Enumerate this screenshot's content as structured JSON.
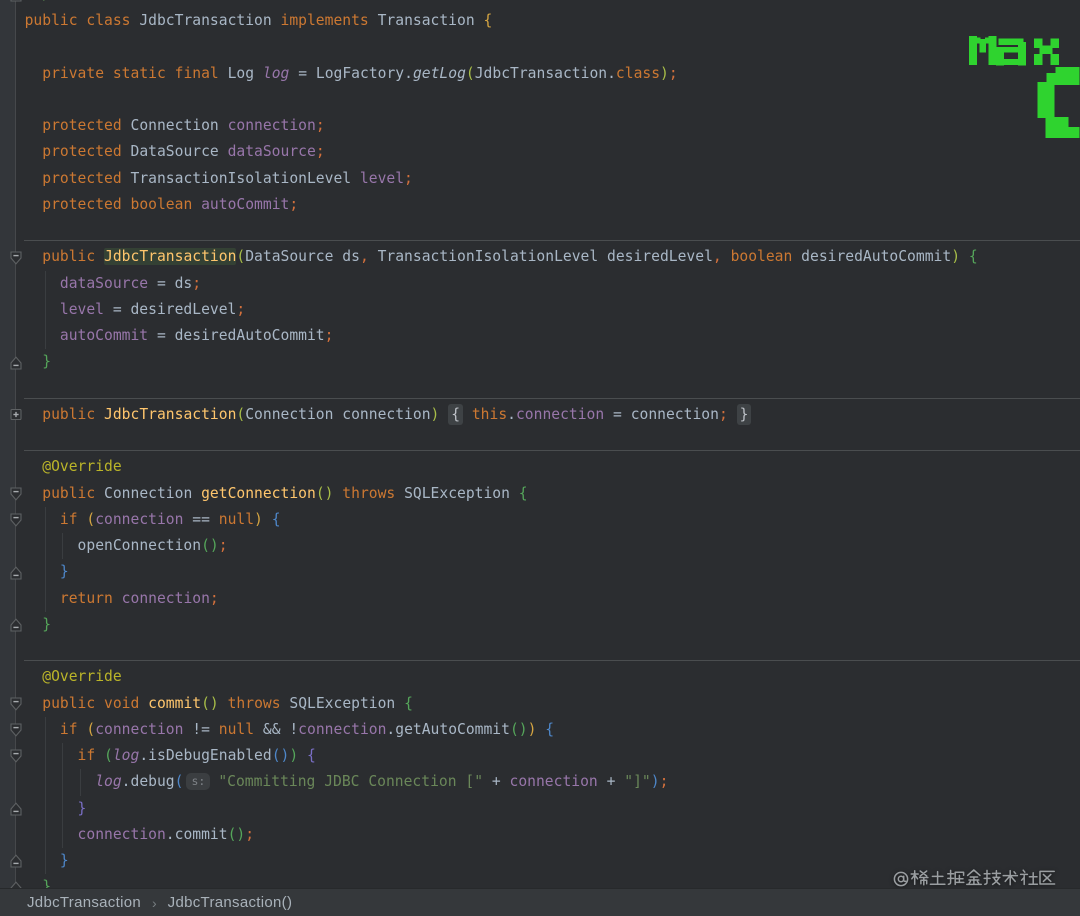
{
  "editor": {
    "language": "java",
    "colors": {
      "background": "#2B2D30",
      "gutter_background": "#33363A",
      "gutter_border": "#46484B",
      "keyword": "#CC7832",
      "text": "#A9B7C6",
      "field": "#9876AA",
      "method_declaration": "#FFC66D",
      "annotation": "#BBB529",
      "string": "#6A8759",
      "semicolon_comma": "#D2703C",
      "javadoc": "#629755",
      "bracket_gold": "#D5A542",
      "bracket_lime": "#A8BE48",
      "bracket_green": "#55A55A",
      "bracket_blue": "#4E87C9",
      "bracket_violet": "#7A6FC6",
      "identifier_under_caret_bg": "#344134",
      "folded_text_bg": "#3E4245",
      "method_separator": "#4A4D4F",
      "indent_guide": "#3A3D40"
    },
    "lines": [
      {
        "tokens": [
          [
            "dc",
            " */"
          ]
        ]
      },
      {
        "tokens": [
          [
            "kw",
            "public"
          ],
          [
            "tx",
            " "
          ],
          [
            "kw",
            "class"
          ],
          [
            "tx",
            " "
          ],
          [
            "tx",
            "JdbcTransaction"
          ],
          [
            "tx",
            " "
          ],
          [
            "kw",
            "implements"
          ],
          [
            "tx",
            " "
          ],
          [
            "tx",
            "Transaction"
          ],
          [
            "tx",
            " "
          ],
          [
            "b1",
            "{"
          ]
        ]
      },
      {
        "tokens": []
      },
      {
        "tokens": [
          [
            "tx",
            "  "
          ],
          [
            "kw",
            "private"
          ],
          [
            "tx",
            " "
          ],
          [
            "kw",
            "static"
          ],
          [
            "tx",
            " "
          ],
          [
            "kw",
            "final"
          ],
          [
            "tx",
            " "
          ],
          [
            "tx",
            "Log"
          ],
          [
            "tx",
            " "
          ],
          [
            "sf",
            "log"
          ],
          [
            "tx",
            " = "
          ],
          [
            "tx",
            "LogFactory"
          ],
          [
            "tx",
            "."
          ],
          [
            "sm",
            "getLog"
          ],
          [
            "b2",
            "("
          ],
          [
            "tx",
            "JdbcTransaction"
          ],
          [
            "tx",
            "."
          ],
          [
            "kw",
            "class"
          ],
          [
            "b2",
            ")"
          ],
          [
            "pu",
            ";"
          ]
        ]
      },
      {
        "tokens": []
      },
      {
        "tokens": [
          [
            "tx",
            "  "
          ],
          [
            "kw",
            "protected"
          ],
          [
            "tx",
            " Connection "
          ],
          [
            "fi",
            "connection"
          ],
          [
            "pu",
            ";"
          ]
        ]
      },
      {
        "tokens": [
          [
            "tx",
            "  "
          ],
          [
            "kw",
            "protected"
          ],
          [
            "tx",
            " DataSource "
          ],
          [
            "fi",
            "dataSource"
          ],
          [
            "pu",
            ";"
          ]
        ]
      },
      {
        "tokens": [
          [
            "tx",
            "  "
          ],
          [
            "kw",
            "protected"
          ],
          [
            "tx",
            " TransactionIsolationLevel "
          ],
          [
            "fi",
            "level"
          ],
          [
            "pu",
            ";"
          ]
        ]
      },
      {
        "tokens": [
          [
            "tx",
            "  "
          ],
          [
            "kw",
            "protected"
          ],
          [
            "tx",
            " "
          ],
          [
            "kw",
            "boolean"
          ],
          [
            "tx",
            " "
          ],
          [
            "fi",
            "autoCommit"
          ],
          [
            "pu",
            ";"
          ]
        ]
      },
      {
        "tokens": []
      },
      {
        "tokens": [
          [
            "tx",
            "  "
          ],
          [
            "kw",
            "public"
          ],
          [
            "tx",
            " "
          ],
          [
            "hm",
            "JdbcTransaction"
          ],
          [
            "b2",
            "("
          ],
          [
            "tx",
            "DataSource ds"
          ],
          [
            "pu",
            ","
          ],
          [
            "tx",
            " TransactionIsolationLevel desiredLevel"
          ],
          [
            "pu",
            ","
          ],
          [
            "tx",
            " "
          ],
          [
            "kw",
            "boolean"
          ],
          [
            "tx",
            " desiredAutoCommit"
          ],
          [
            "b2",
            ")"
          ],
          [
            "tx",
            " "
          ],
          [
            "b3",
            "{"
          ]
        ]
      },
      {
        "tokens": [
          [
            "tx",
            "    "
          ],
          [
            "fi",
            "dataSource"
          ],
          [
            "tx",
            " = ds"
          ],
          [
            "pu",
            ";"
          ]
        ]
      },
      {
        "tokens": [
          [
            "tx",
            "    "
          ],
          [
            "fi",
            "level"
          ],
          [
            "tx",
            " = desiredLevel"
          ],
          [
            "pu",
            ";"
          ]
        ]
      },
      {
        "tokens": [
          [
            "tx",
            "    "
          ],
          [
            "fi",
            "autoCommit"
          ],
          [
            "tx",
            " = desiredAutoCommit"
          ],
          [
            "pu",
            ";"
          ]
        ]
      },
      {
        "tokens": [
          [
            "tx",
            "  "
          ],
          [
            "b3",
            "}"
          ]
        ]
      },
      {
        "tokens": []
      },
      {
        "tokens": [
          [
            "tx",
            "  "
          ],
          [
            "kw",
            "public"
          ],
          [
            "tx",
            " "
          ],
          [
            "me",
            "JdbcTransaction"
          ],
          [
            "b2",
            "("
          ],
          [
            "tx",
            "Connection connection"
          ],
          [
            "b2",
            ")"
          ],
          [
            "tx",
            " "
          ],
          [
            "fd",
            "{"
          ],
          [
            "tx",
            " "
          ],
          [
            "kw",
            "this"
          ],
          [
            "tx",
            "."
          ],
          [
            "fi",
            "connection"
          ],
          [
            "tx",
            " = connection"
          ],
          [
            "pu",
            ";"
          ],
          [
            "tx",
            " "
          ],
          [
            "fd",
            "}"
          ]
        ]
      },
      {
        "tokens": []
      },
      {
        "tokens": [
          [
            "tx",
            "  "
          ],
          [
            "an",
            "@Override"
          ]
        ]
      },
      {
        "tokens": [
          [
            "tx",
            "  "
          ],
          [
            "kw",
            "public"
          ],
          [
            "tx",
            " Connection "
          ],
          [
            "me",
            "getConnection"
          ],
          [
            "b2",
            "()"
          ],
          [
            "tx",
            " "
          ],
          [
            "kw",
            "throws"
          ],
          [
            "tx",
            " SQLException "
          ],
          [
            "b3",
            "{"
          ]
        ]
      },
      {
        "tokens": [
          [
            "tx",
            "    "
          ],
          [
            "kw",
            "if"
          ],
          [
            "tx",
            " "
          ],
          [
            "b1",
            "("
          ],
          [
            "fi",
            "connection"
          ],
          [
            "tx",
            " == "
          ],
          [
            "kw",
            "null"
          ],
          [
            "b1",
            ")"
          ],
          [
            "tx",
            " "
          ],
          [
            "b4",
            "{"
          ]
        ]
      },
      {
        "tokens": [
          [
            "tx",
            "      "
          ],
          [
            "tx",
            "openConnection"
          ],
          [
            "b3",
            "()"
          ],
          [
            "pu",
            ";"
          ]
        ]
      },
      {
        "tokens": [
          [
            "tx",
            "    "
          ],
          [
            "b4",
            "}"
          ]
        ]
      },
      {
        "tokens": [
          [
            "tx",
            "    "
          ],
          [
            "kw",
            "return"
          ],
          [
            "tx",
            " "
          ],
          [
            "fi",
            "connection"
          ],
          [
            "pu",
            ";"
          ]
        ]
      },
      {
        "tokens": [
          [
            "tx",
            "  "
          ],
          [
            "b3",
            "}"
          ]
        ]
      },
      {
        "tokens": []
      },
      {
        "tokens": [
          [
            "tx",
            "  "
          ],
          [
            "an",
            "@Override"
          ]
        ]
      },
      {
        "tokens": [
          [
            "tx",
            "  "
          ],
          [
            "kw",
            "public"
          ],
          [
            "tx",
            " "
          ],
          [
            "kw",
            "void"
          ],
          [
            "tx",
            " "
          ],
          [
            "me",
            "commit"
          ],
          [
            "b2",
            "()"
          ],
          [
            "tx",
            " "
          ],
          [
            "kw",
            "throws"
          ],
          [
            "tx",
            " SQLException "
          ],
          [
            "b3",
            "{"
          ]
        ]
      },
      {
        "tokens": [
          [
            "tx",
            "    "
          ],
          [
            "kw",
            "if"
          ],
          [
            "tx",
            " "
          ],
          [
            "b1",
            "("
          ],
          [
            "fi",
            "connection"
          ],
          [
            "tx",
            " != "
          ],
          [
            "kw",
            "null"
          ],
          [
            "tx",
            " && !"
          ],
          [
            "fi",
            "connection"
          ],
          [
            "tx",
            ".getAutoCommit"
          ],
          [
            "b3",
            "()"
          ],
          [
            "b1",
            ")"
          ],
          [
            "tx",
            " "
          ],
          [
            "b4",
            "{"
          ]
        ]
      },
      {
        "tokens": [
          [
            "tx",
            "      "
          ],
          [
            "kw",
            "if"
          ],
          [
            "tx",
            " "
          ],
          [
            "b3",
            "("
          ],
          [
            "sf",
            "log"
          ],
          [
            "tx",
            ".isDebugEnabled"
          ],
          [
            "b4",
            "()"
          ],
          [
            "b3",
            ")"
          ],
          [
            "tx",
            " "
          ],
          [
            "b5",
            "{"
          ]
        ]
      },
      {
        "tokens": [
          [
            "tx",
            "        "
          ],
          [
            "sf",
            "log"
          ],
          [
            "tx",
            ".debug"
          ],
          [
            "b4",
            "("
          ],
          [
            "hint",
            "s:"
          ],
          [
            "st",
            "\"Committing JDBC Connection [\""
          ],
          [
            "tx",
            " + "
          ],
          [
            "fi",
            "connection"
          ],
          [
            "tx",
            " + "
          ],
          [
            "st",
            "\"]\""
          ],
          [
            "b4",
            ")"
          ],
          [
            "pu",
            ";"
          ]
        ]
      },
      {
        "tokens": [
          [
            "tx",
            "      "
          ],
          [
            "b5",
            "}"
          ]
        ]
      },
      {
        "tokens": [
          [
            "tx",
            "      "
          ],
          [
            "fi",
            "connection"
          ],
          [
            "tx",
            ".commit"
          ],
          [
            "b3",
            "()"
          ],
          [
            "pu",
            ";"
          ]
        ]
      },
      {
        "tokens": [
          [
            "tx",
            "    "
          ],
          [
            "b4",
            "}"
          ]
        ]
      },
      {
        "tokens": [
          [
            "tx",
            "  "
          ],
          [
            "b3",
            "}"
          ]
        ]
      }
    ],
    "fold_markers": [
      {
        "line": 0,
        "type": "up"
      },
      {
        "line": 10,
        "type": "down"
      },
      {
        "line": 14,
        "type": "up"
      },
      {
        "line": 16,
        "type": "plus"
      },
      {
        "line": 19,
        "type": "down"
      },
      {
        "line": 20,
        "type": "down"
      },
      {
        "line": 22,
        "type": "up"
      },
      {
        "line": 24,
        "type": "up"
      },
      {
        "line": 27,
        "type": "down"
      },
      {
        "line": 28,
        "type": "down"
      },
      {
        "line": 29,
        "type": "down"
      },
      {
        "line": 31,
        "type": "up"
      },
      {
        "line": 33,
        "type": "up"
      },
      {
        "line": 34,
        "type": "up"
      }
    ],
    "method_separators_before_lines": [
      10,
      16,
      18,
      26
    ],
    "indent_guides": [
      {
        "col": 2,
        "from": 11,
        "to": 14
      },
      {
        "col": 2,
        "from": 20,
        "to": 24
      },
      {
        "col": 4,
        "from": 21,
        "to": 22
      },
      {
        "col": 2,
        "from": 28,
        "to": 34
      },
      {
        "col": 4,
        "from": 29,
        "to": 33
      },
      {
        "col": 6,
        "from": 30,
        "to": 31
      }
    ],
    "inlay_hint_text": "s:"
  },
  "breadcrumbs": {
    "items": [
      "JdbcTransaction",
      "JdbcTransaction()"
    ],
    "separator": "›"
  },
  "watermarks": {
    "uploader": "Max",
    "uploader_color": "#2FD32F",
    "community": "@稀土掘金技术社区",
    "community_color": "#9A9EA1"
  }
}
